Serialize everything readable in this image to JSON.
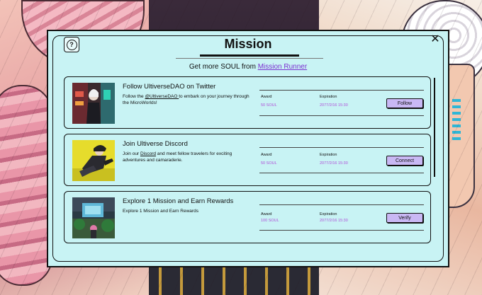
{
  "modal": {
    "title": "Mission",
    "subtitle_prefix": "Get more SOUL from ",
    "subtitle_link": "Mission Runner",
    "help_icon": "question-icon",
    "close_icon": "close-icon"
  },
  "missions": [
    {
      "title": "Follow UltiverseDAO on Twitter",
      "desc_pre": "Follow the ",
      "desc_link": "@UltiverseDAO ",
      "desc_post": "to embark on your journey through the MicroWorlds!",
      "award_label": "Award",
      "award": "50 SOUL",
      "expiration_label": "Expiration",
      "expiration": "2077/2/16 15:30",
      "action": "Follow"
    },
    {
      "title": "Join Ultiverse Discord",
      "desc_pre": "Join our ",
      "desc_link": "Discord",
      "desc_post": " and meet fellow travelers for exciting adventures and camaraderie.",
      "award_label": "Award",
      "award": "50 SOUL",
      "expiration_label": "Expiration",
      "expiration": "2077/2/16 15:30",
      "action": "Connect"
    },
    {
      "title": "Explore 1 Mission and Earn Rewards",
      "desc_pre": "Explore 1 Mission and Earn Rewards",
      "desc_link": "",
      "desc_post": "",
      "award_label": "Award",
      "award": "100 SOUL",
      "expiration_label": "Expiration",
      "expiration": "2077/2/16 15:30",
      "action": "Verify"
    }
  ],
  "colors": {
    "panel": "#c8f3f4",
    "accent_link": "#7b2fd0",
    "value_text": "#b04fd8",
    "button": "#c9b8f4"
  }
}
